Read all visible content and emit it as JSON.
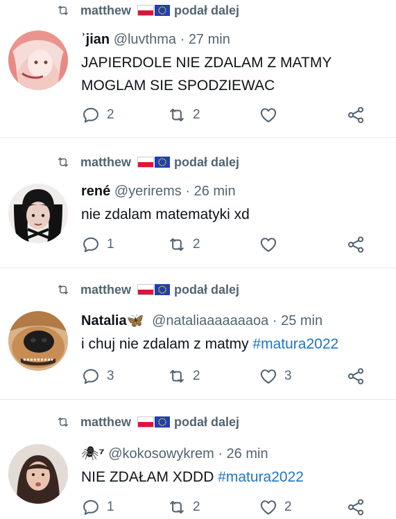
{
  "retweeter": {
    "name": "matthew",
    "suffix": "podał dalej"
  },
  "tweets": [
    {
      "name": "ʾjian",
      "handle": "@luvthma",
      "time": "27 min",
      "lines": [
        "JAPIERDOLE NIE ZDALAM Z MATMY",
        "MOGLAM SIE SPODZIEWAC"
      ],
      "replies": "2",
      "retweets": "2",
      "likes": ""
    },
    {
      "name": "rené",
      "handle": "@yerirems",
      "time": "26 min",
      "lines": [
        "nie zdalam matematyki xd"
      ],
      "replies": "1",
      "retweets": "2",
      "likes": ""
    },
    {
      "name": "Natalia",
      "handle": "@nataliaaaaaaaoa",
      "time": "25 min",
      "text": "i chuj nie zdalam z matmy ",
      "hashtag": "#matura2022",
      "replies": "3",
      "retweets": "2",
      "likes": "3"
    },
    {
      "name": "⁷",
      "handle": "@kokosowykrem",
      "time": "26 min",
      "text": "NIE ZDAŁAM XDDD ",
      "hashtag": "#matura2022",
      "replies": "1",
      "retweets": "2",
      "likes": "2"
    }
  ],
  "colors": {
    "secondary": "#536471",
    "link": "#1d75c9",
    "divider": "#e6e9ec"
  },
  "icons": [
    "retweet-icon",
    "reply-icon",
    "like-icon",
    "share-icon",
    "poland-flag-icon",
    "eu-flag-icon",
    "butterfly-icon",
    "spider-icon"
  ]
}
